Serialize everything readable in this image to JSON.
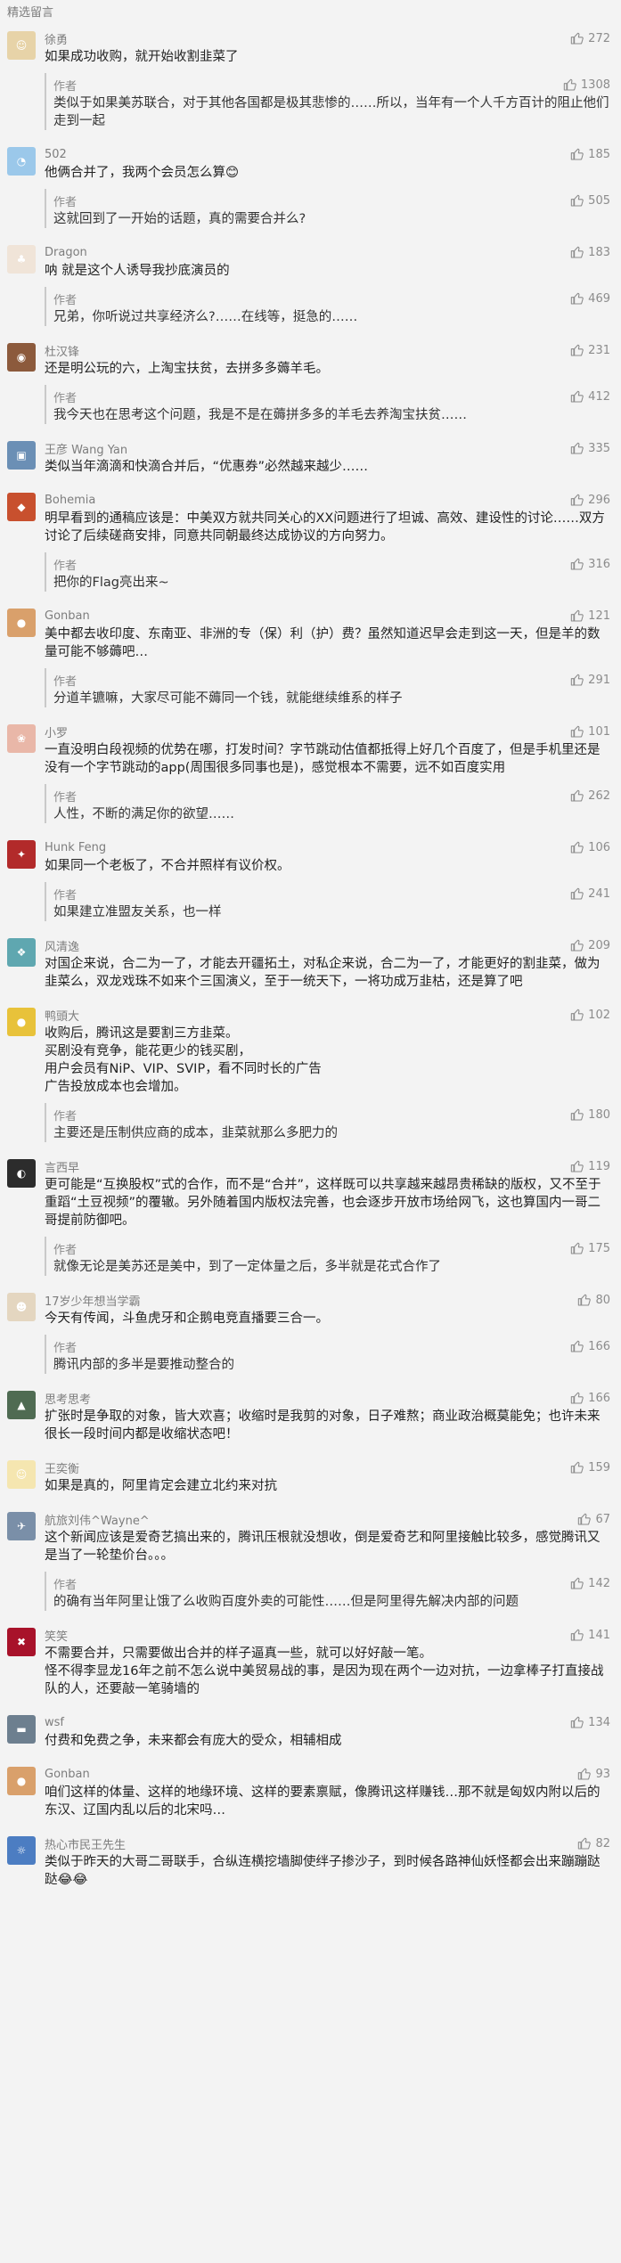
{
  "section_title": "精选留言",
  "author_label": "作者",
  "comments": [
    {
      "nickname": "徐勇",
      "likes": "272",
      "text": "如果成功收购，就开始收割韭菜了",
      "avatar": {
        "color": "#e7d3a8",
        "glyph": "☺"
      },
      "reply": {
        "likes": "1308",
        "text": "类似于如果美苏联合，对于其他各国都是极其悲惨的……所以，当年有一个人千方百计的阻止他们走到一起"
      }
    },
    {
      "nickname": "502",
      "likes": "185",
      "text": "他俩合并了，我两个会员怎么算",
      "emoji": "😊",
      "avatar": {
        "color": "#9bc8ea",
        "glyph": "◔"
      },
      "reply": {
        "likes": "505",
        "text": "这就回到了一开始的话题，真的需要合并么?"
      }
    },
    {
      "nickname": "Dragon",
      "likes": "183",
      "text": "呐 就是这个人诱导我抄底演员的",
      "avatar": {
        "color": "#f0e4d8",
        "glyph": "♣"
      },
      "reply": {
        "likes": "469",
        "text": "兄弟，你听说过共享经济么?……在线等，挺急的……"
      }
    },
    {
      "nickname": "杜汉锋",
      "likes": "231",
      "text": "还是明公玩的六，上淘宝扶贫，去拼多多薅羊毛。",
      "avatar": {
        "color": "#8c5a3c",
        "glyph": "◉"
      },
      "reply": {
        "likes": "412",
        "text": "我今天也在思考这个问题，我是不是在薅拼多多的羊毛去养淘宝扶贫……"
      }
    },
    {
      "nickname": "王彦 Wang Yan",
      "likes": "335",
      "text": "类似当年滴滴和快滴合并后，“优惠券”必然越来越少……",
      "avatar": {
        "color": "#6b8fb5",
        "glyph": "▣"
      },
      "reply": null
    },
    {
      "nickname": "Bohemia",
      "likes": "296",
      "text": "明早看到的通稿应该是：中美双方就共同关心的XX问题进行了坦诚、高效、建设性的讨论……双方讨论了后续磋商安排，同意共同朝最终达成协议的方向努力。",
      "avatar": {
        "color": "#c8502e",
        "glyph": "◆"
      },
      "reply": {
        "likes": "316",
        "text": "把你的Flag亮出来~"
      }
    },
    {
      "nickname": "Gonban",
      "likes": "121",
      "text": "美中都去收印度、东南亚、非洲的专（保）利（护）费？虽然知道迟早会走到这一天，但是羊的数量可能不够薅吧…",
      "avatar": {
        "color": "#d9a06b",
        "glyph": "●"
      },
      "reply": {
        "likes": "291",
        "text": "分道羊镳嘛，大家尽可能不薅同一个钱，就能继续维系的样子"
      }
    },
    {
      "nickname": "小罗",
      "likes": "101",
      "text": "一直没明白段视频的优势在哪，打发时间？字节跳动估值都抵得上好几个百度了，但是手机里还是没有一个字节跳动的app(周围很多同事也是)，感觉根本不需要，远不如百度实用",
      "avatar": {
        "color": "#e9b7a8",
        "glyph": "❀"
      },
      "reply": {
        "likes": "262",
        "text": "人性，不断的满足你的欲望……"
      }
    },
    {
      "nickname": "Hunk Feng",
      "likes": "106",
      "text": "如果同一个老板了，不合并照样有议价权。",
      "avatar": {
        "color": "#b22a2a",
        "glyph": "✦"
      },
      "reply": {
        "likes": "241",
        "text": "如果建立准盟友关系，也一样"
      }
    },
    {
      "nickname": "风清逸",
      "likes": "209",
      "text": "对国企来说，合二为一了，才能去开疆拓土，对私企来说，合二为一了，才能更好的割韭菜，做为韭菜么，双龙戏珠不如来个三国演义，至于一统天下，一将功成万韭枯，还是算了吧",
      "avatar": {
        "color": "#5fa7b0",
        "glyph": "❖"
      },
      "reply": null
    },
    {
      "nickname": "鸭頭大",
      "likes": "102",
      "text": "收购后，腾讯这是要割三方韭菜。\n买剧没有竞争，能花更少的钱买剧，\n用户会员有NiP、VIP、SVIP，看不同时长的广告\n广告投放成本也会增加。",
      "avatar": {
        "color": "#e8c23a",
        "glyph": "●"
      },
      "reply": {
        "likes": "180",
        "text": "主要还是压制供应商的成本，韭菜就那么多肥力的"
      }
    },
    {
      "nickname": "言西早",
      "likes": "119",
      "text": "更可能是“互换股权”式的合作，而不是“合并”，这样既可以共享越来越昂贵稀缺的版权，又不至于重蹈“土豆视频”的覆辙。另外随着国内版权法完善，也会逐步开放市场给网飞，这也算国内一哥二哥提前防御吧。",
      "avatar": {
        "color": "#2c2c2c",
        "glyph": "◐"
      },
      "reply": {
        "likes": "175",
        "text": "就像无论是美苏还是美中，到了一定体量之后，多半就是花式合作了"
      }
    },
    {
      "nickname": "17岁少年想当学霸",
      "likes": "80",
      "text": "今天有传闻，斗鱼虎牙和企鹅电竞直播要三合一。",
      "avatar": {
        "color": "#e4d6c0",
        "glyph": "☻"
      },
      "reply": {
        "likes": "166",
        "text": "腾讯内部的多半是要推动整合的"
      }
    },
    {
      "nickname": "思考思考",
      "likes": "166",
      "text": "扩张时是争取的对象，皆大欢喜；收缩时是我剪的对象，日子难熬；商业政治概莫能免；也许未来很长一段时间内都是收缩状态吧！",
      "avatar": {
        "color": "#4f6b52",
        "glyph": "▲"
      },
      "reply": null
    },
    {
      "nickname": "王奕衡",
      "likes": "159",
      "text": "如果是真的，阿里肯定会建立北约来对抗",
      "avatar": {
        "color": "#f5e6b0",
        "glyph": "☺"
      },
      "reply": null
    },
    {
      "nickname": "航旅刘伟^Wayne^",
      "likes": "67",
      "text": "这个新闻应该是爱奇艺搞出来的，腾讯压根就没想收，倒是爱奇艺和阿里接触比较多，感觉腾讯又是当了一轮垫价台。。。",
      "avatar": {
        "color": "#7a8fa8",
        "glyph": "✈"
      },
      "reply": {
        "likes": "142",
        "text": "的确有当年阿里让饿了么收购百度外卖的可能性……但是阿里得先解决内部的问题"
      }
    },
    {
      "nickname": "笑笑",
      "likes": "141",
      "text": "不需要合并，只需要做出合并的样子逼真一些，就可以好好敲一笔。\n怪不得李显龙16年之前不怎么说中美贸易战的事，是因为现在两个一边对抗，一边拿棒子打直接战队的人，还要敲一笔骑墙的",
      "avatar": {
        "color": "#a8122a",
        "glyph": "✖"
      },
      "reply": null
    },
    {
      "nickname": "wsf",
      "likes": "134",
      "text": "付费和免费之争，未来都会有庞大的受众，相辅相成",
      "avatar": {
        "color": "#6d7f8f",
        "glyph": "▬"
      },
      "reply": null
    },
    {
      "nickname": "Gonban",
      "likes": "93",
      "text": "咱们这样的体量、这样的地缘环境、这样的要素禀赋，像腾讯这样赚钱…那不就是匈奴内附以后的东汉、辽国内乱以后的北宋吗…",
      "avatar": {
        "color": "#d9a06b",
        "glyph": "●"
      },
      "reply": null
    },
    {
      "nickname": "热心市民王先生",
      "likes": "82",
      "text": "类似于昨天的大哥二哥联手，合纵连横挖墙脚使绊子掺沙子，到时候各路神仙妖怪都会出来蹦蹦跶跶",
      "emoji": "😂😂",
      "avatar": {
        "color": "#4c7dc2",
        "glyph": "☼"
      },
      "reply": null
    }
  ]
}
